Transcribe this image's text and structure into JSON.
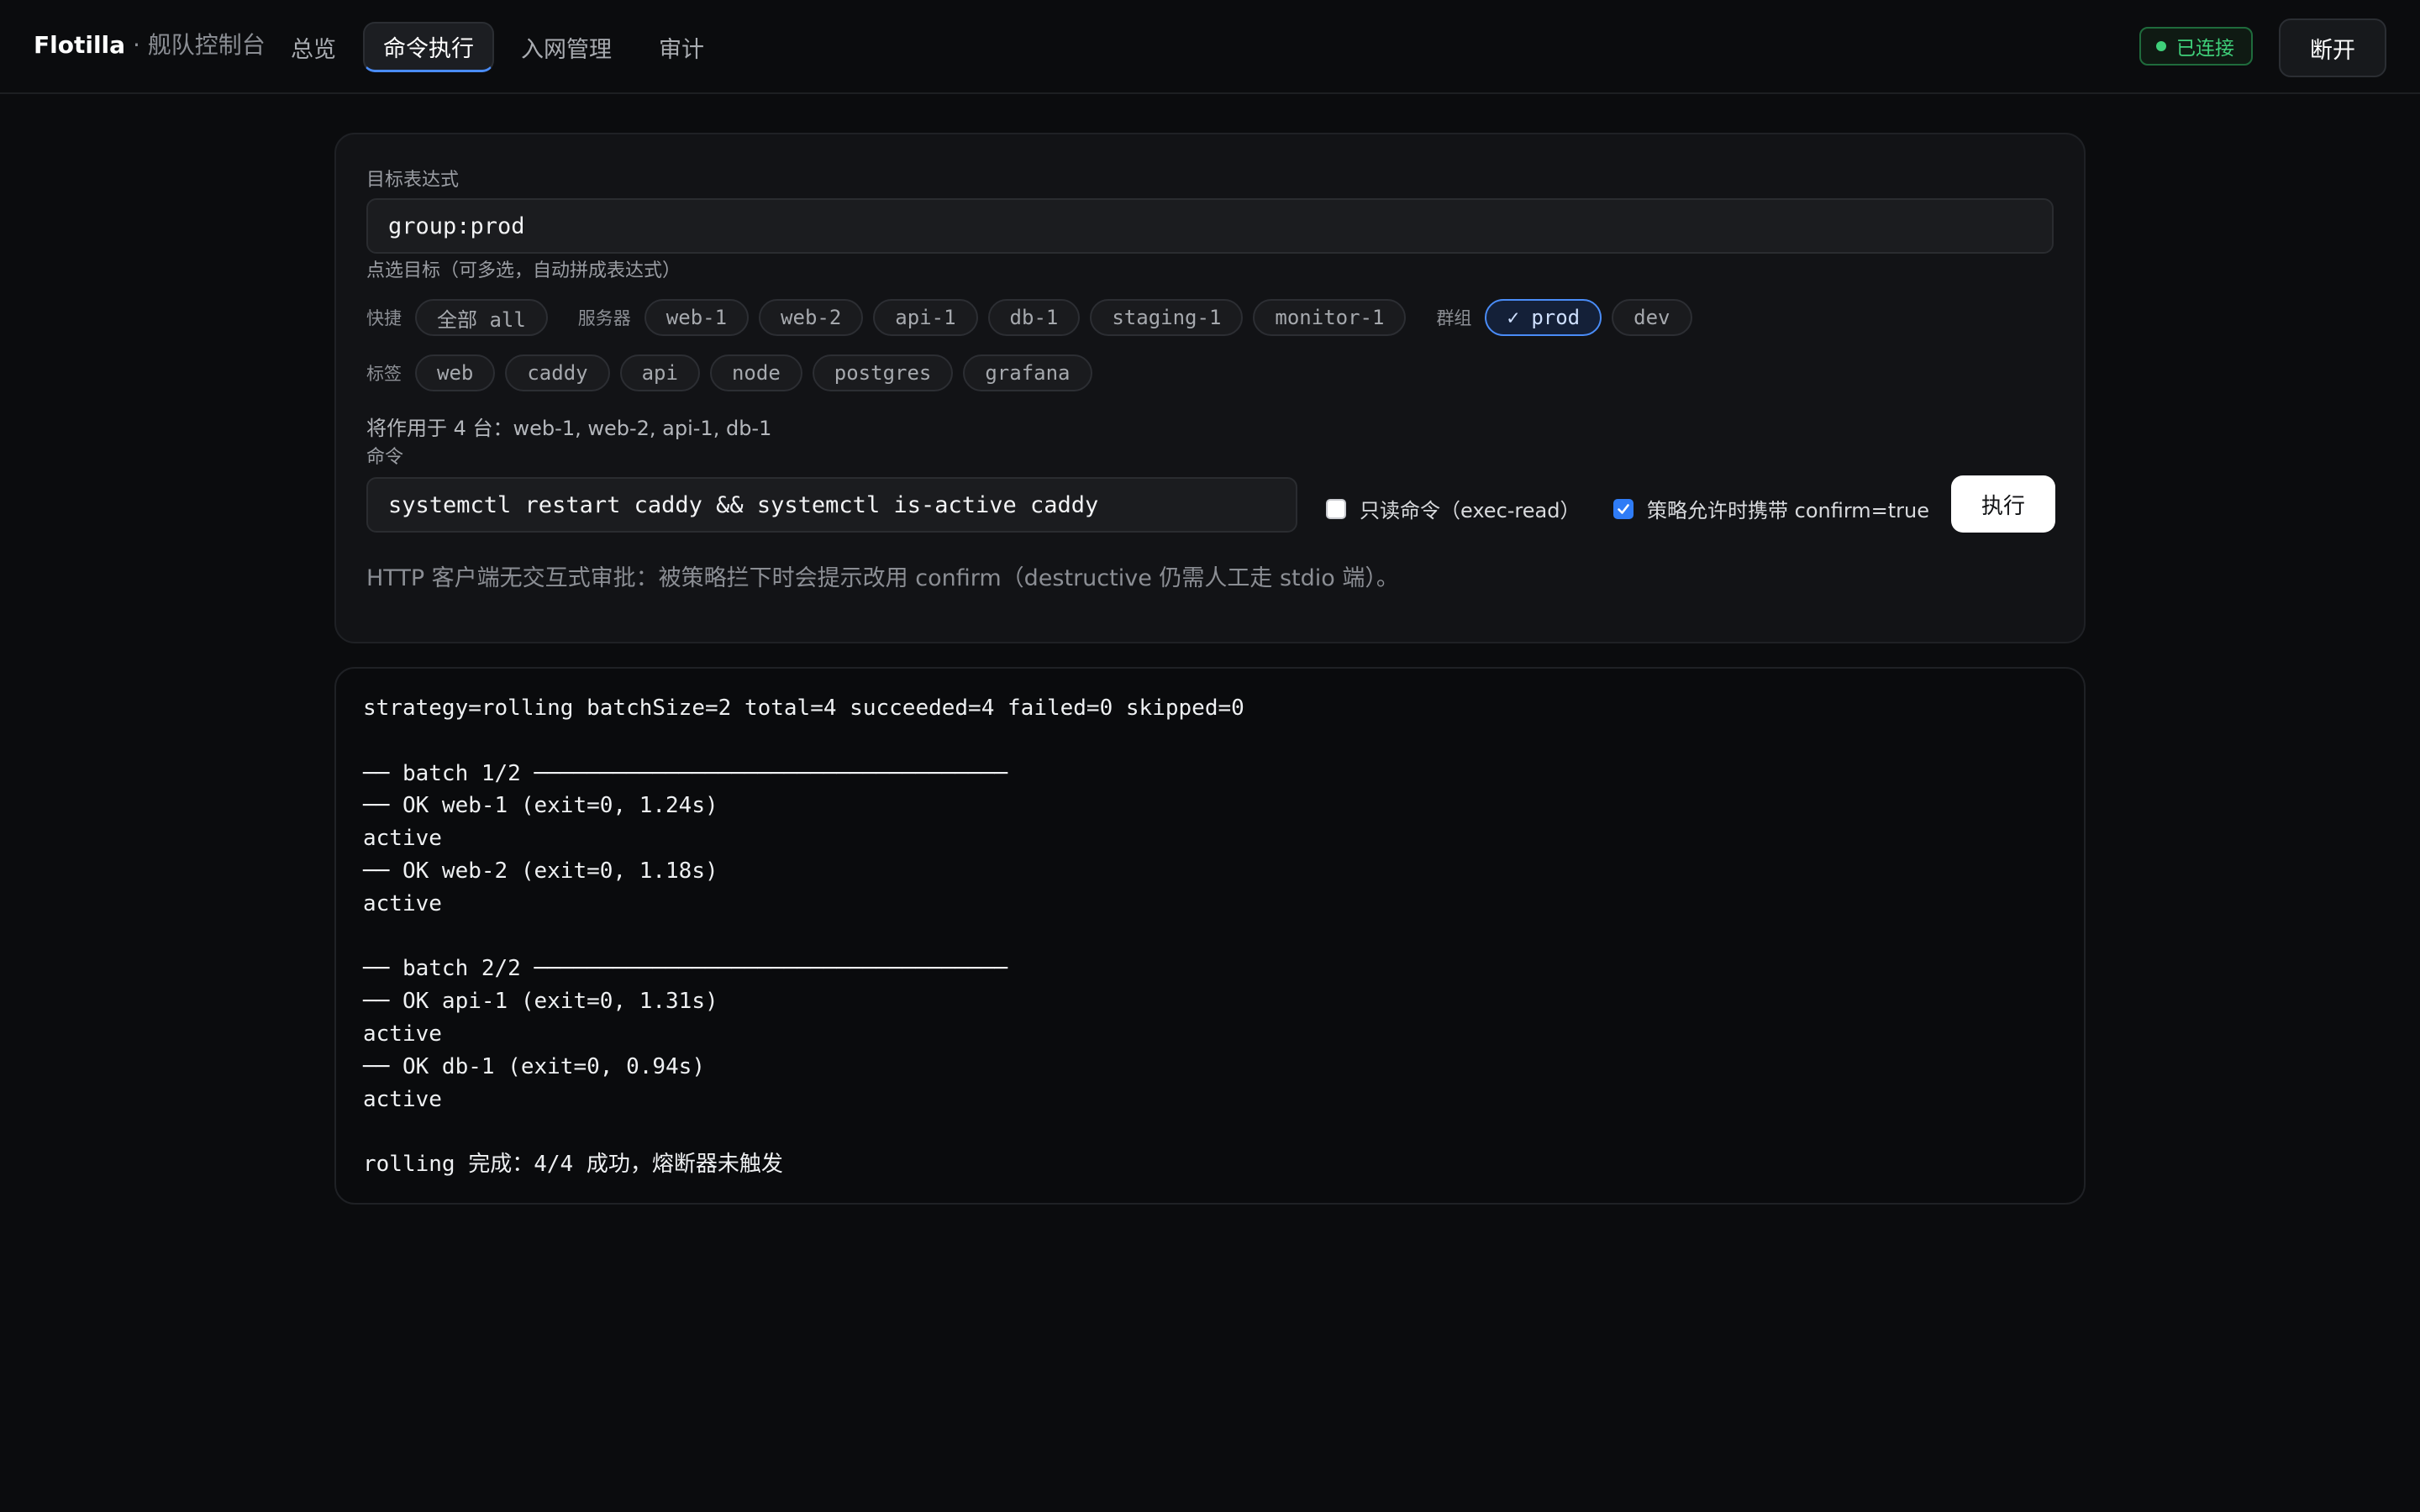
{
  "header": {
    "brand_name": "Flotilla",
    "brand_sep": " · ",
    "brand_subtitle": "舰队控制台",
    "nav": [
      {
        "label": "总览",
        "active": false
      },
      {
        "label": "命令执行",
        "active": true
      },
      {
        "label": "入网管理",
        "active": false
      },
      {
        "label": "审计",
        "active": false
      }
    ],
    "status": "已连接",
    "disconnect_label": "断开"
  },
  "form": {
    "target_label": "目标表达式",
    "target_value": "group:prod",
    "pick_hint": "点选目标（可多选，自动拼成表达式）",
    "quick_label": "快捷",
    "quick_chips": [
      "全部 all"
    ],
    "servers_label": "服务器",
    "server_chips": [
      "web-1",
      "web-2",
      "api-1",
      "db-1",
      "staging-1",
      "monitor-1"
    ],
    "groups_label": "群组",
    "group_chips": [
      {
        "label": "✓ prod",
        "selected": true
      },
      {
        "label": "dev",
        "selected": false
      }
    ],
    "tags_label": "标签",
    "tag_chips": [
      "web",
      "caddy",
      "api",
      "node",
      "postgres",
      "grafana"
    ],
    "affect_text": "将作用于 4 台：web-1, web-2, api-1, db-1",
    "command_label": "命令",
    "command_value": "systemctl restart caddy && systemctl is-active caddy",
    "readonly_label": "只读命令（exec-read）",
    "readonly_checked": false,
    "confirm_label": "策略允许时携带 confirm=true",
    "confirm_checked": true,
    "exec_label": "执行",
    "http_hint": "HTTP 客户端无交互式审批：被策略拦下时会提示改用 confirm（destructive 仍需人工走 stdio 端）。"
  },
  "output": {
    "lines": [
      "strategy=rolling batchSize=2 total=4 succeeded=4 failed=0 skipped=0",
      "",
      "── batch 1/2 ────────────────────────────────────",
      "── OK web-1 (exit=0, 1.24s)",
      "active",
      "── OK web-2 (exit=0, 1.18s)",
      "active",
      "",
      "── batch 2/2 ────────────────────────────────────",
      "── OK api-1 (exit=0, 1.31s)",
      "active",
      "── OK db-1 (exit=0, 0.94s)",
      "active",
      "",
      "rolling 完成：4/4 成功，熔断器未触发"
    ]
  },
  "colors": {
    "background": "#0b0c0e",
    "accent": "#4a8cf7",
    "success": "#3fd07a"
  }
}
